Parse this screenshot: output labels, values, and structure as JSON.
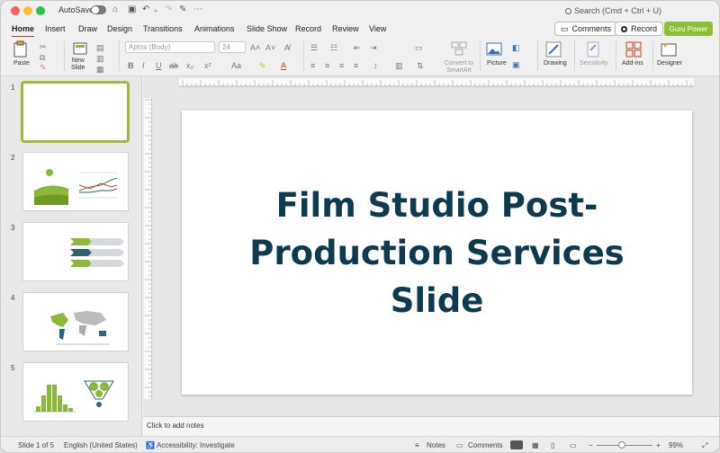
{
  "titlebar": {
    "autosave_label": "AutoSave",
    "search_placeholder": "Search (Cmd + Ctrl + U)"
  },
  "tabs": [
    "Home",
    "Insert",
    "Draw",
    "Design",
    "Transitions",
    "Animations",
    "Slide Show",
    "Record",
    "Review",
    "View"
  ],
  "header_buttons": {
    "comments": "Comments",
    "record": "Record",
    "guru": "Guru Power"
  },
  "ribbon": {
    "paste": "Paste",
    "new_slide_line1": "New",
    "new_slide_line2": "Slide",
    "font_name": "Aptos (Body)",
    "font_size": "24",
    "convert_line1": "Convert to",
    "convert_line2": "SmartArt",
    "picture": "Picture",
    "drawing": "Drawing",
    "sensitivity": "Sensitivity",
    "addins": "Add-ins",
    "designer": "Designer",
    "bold": "B",
    "italic": "I",
    "underline": "U",
    "strike": "ab",
    "sub": "x₂",
    "sup": "x²",
    "case": "Aa",
    "grow": "A˄",
    "shrink": "A˅"
  },
  "thumbnails": [
    "1",
    "2",
    "3",
    "4",
    "5"
  ],
  "slide": {
    "title": "Film Studio Post-Production Services Slide"
  },
  "notes_placeholder": "Click to add notes",
  "status": {
    "slide_count": "Slide 1 of 5",
    "language": "English (United States)",
    "accessibility": "Accessibility: Investigate",
    "notes": "Notes",
    "comments": "Comments",
    "zoom": "99%"
  },
  "colors": {
    "accent": "#c43e1c",
    "title": "#0e3a50",
    "guru": "#8cbf35",
    "thumb_green": "#8cb83a",
    "thumb_blue": "#2f5f7a"
  }
}
